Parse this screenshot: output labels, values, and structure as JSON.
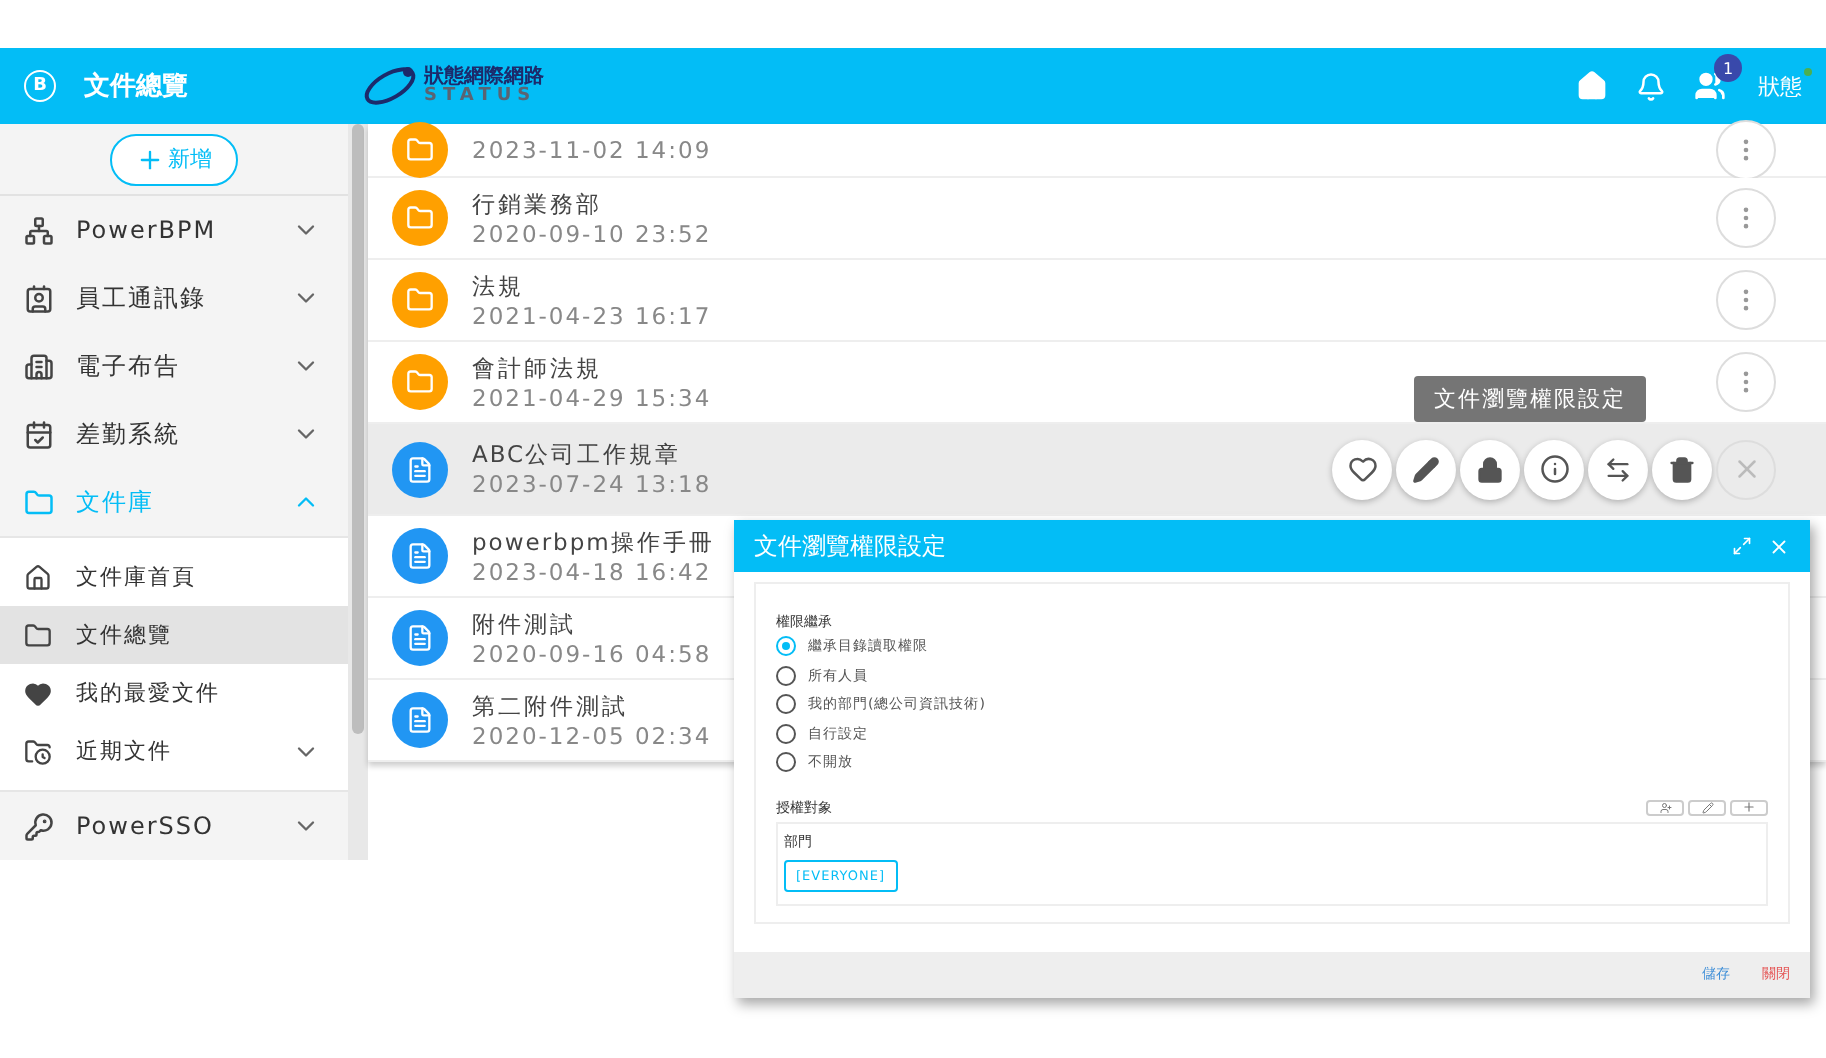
{
  "header": {
    "app_badge": "B",
    "title": "文件總覽",
    "logo_text": "狀態網際網路",
    "logo_sub": "STATUS",
    "notification_count": "1",
    "user": "狀態"
  },
  "sidebar": {
    "add_button": "新增",
    "items": [
      {
        "label": "PowerBPM",
        "kind": "group",
        "expanded": false,
        "selected": false
      },
      {
        "label": "員工通訊錄",
        "kind": "group",
        "expanded": false,
        "selected": false
      },
      {
        "label": "電子布告",
        "kind": "group",
        "expanded": false,
        "selected": false
      },
      {
        "label": "差勤系統",
        "kind": "group",
        "expanded": false,
        "selected": false
      },
      {
        "label": "文件庫",
        "kind": "group",
        "expanded": true,
        "selected": true,
        "children": [
          {
            "label": "文件庫首頁",
            "kind": "link",
            "selected": false
          },
          {
            "label": "文件總覽",
            "kind": "link",
            "selected": true
          },
          {
            "label": "我的最愛文件",
            "kind": "link",
            "selected": false
          },
          {
            "label": "近期文件",
            "kind": "group",
            "expanded": false,
            "selected": false
          }
        ]
      },
      {
        "label": "PowerSSO",
        "kind": "group",
        "expanded": false,
        "selected": false
      }
    ]
  },
  "files": [
    {
      "kind": "folder",
      "date": "2023-11-02 14:09",
      "selected": false,
      "menu": true
    },
    {
      "kind": "folder",
      "title": "行銷業務部",
      "date": "2020-09-10 23:52",
      "selected": false,
      "menu": true
    },
    {
      "kind": "folder",
      "title": "法規",
      "date": "2021-04-23 16:17",
      "selected": false,
      "menu": true
    },
    {
      "kind": "folder",
      "title": "會計師法規",
      "date": "2021-04-29 15:34",
      "selected": false,
      "menu": true
    },
    {
      "kind": "document",
      "title": "ABC公司工作規章",
      "date": "2023-07-24 13:18",
      "selected": true
    },
    {
      "kind": "document",
      "title": "powerbpm操作手冊",
      "date": "2023-04-18 16:42",
      "selected": false
    },
    {
      "kind": "document",
      "title": "附件測試",
      "date": "2020-09-16 04:58",
      "selected": false
    },
    {
      "kind": "document",
      "title": "第二附件測試",
      "date": "2020-12-05 02:34",
      "selected": false
    }
  ],
  "action_tooltip": "文件瀏覽權限設定",
  "dialog": {
    "title": "文件瀏覽權限設定",
    "section_label": "權限繼承",
    "options": [
      {
        "label": "繼承目錄讀取權限",
        "selected": true
      },
      {
        "label": "所有人員",
        "selected": false
      },
      {
        "label": "我的部門(總公司資訊技術)",
        "selected": false
      },
      {
        "label": "自行設定",
        "selected": false
      },
      {
        "label": "不開放",
        "selected": false
      }
    ],
    "grant_label": "授權對象",
    "group_label": "部門",
    "tags": [
      "[EVERYONE]"
    ],
    "buttons": [
      {
        "label": "儲存",
        "kind": "primary"
      },
      {
        "label": "關閉",
        "kind": "danger"
      }
    ]
  }
}
